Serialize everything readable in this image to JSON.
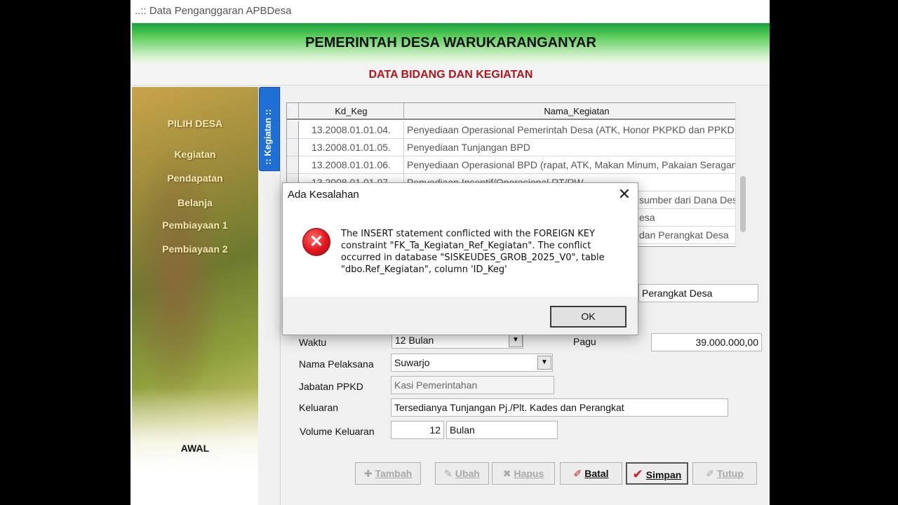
{
  "window": {
    "title": "..:: Data Penganggaran APBDesa"
  },
  "header": {
    "banner": "PEMERINTAH DESA WARUKARANGANYAR",
    "subtitle": "DATA BIDANG DAN KEGIATAN"
  },
  "sidebar": {
    "items": [
      {
        "label": "PILIH DESA"
      },
      {
        "label": "Kegiatan"
      },
      {
        "label": "Pendapatan"
      },
      {
        "label": "Belanja"
      },
      {
        "label": "Pembiayaan 1"
      },
      {
        "label": "Pembiayaan 2"
      }
    ],
    "awal": "AWAL"
  },
  "vertical_tab": {
    "label": ":: Kegiatan ::"
  },
  "grid": {
    "columns": [
      "Kd_Keg",
      "Nama_Kegiatan"
    ],
    "rows": [
      {
        "kd": "13.2008.01.01.04.",
        "nama": "Penyediaan Operasional Pemerintah Desa (ATK, Honor PKPKD dan PPKD dll)"
      },
      {
        "kd": "13.2008.01.01.05.",
        "nama": "Penyediaan Tunjangan BPD"
      },
      {
        "kd": "13.2008.01.01.06.",
        "nama": "Penyediaan Operasional BPD (rapat, ATK, Makan Minum, Pakaian Seragam, L"
      },
      {
        "kd": "13.2008.01.01.07.",
        "nama": "Penyediaan Insentif/Operasional RT/RW"
      },
      {
        "kd": "",
        "nama": "sumber dari Dana Desa"
      },
      {
        "kd": "",
        "nama": "esa"
      },
      {
        "kd": "",
        "nama": "dan Perangkat Desa"
      }
    ]
  },
  "form": {
    "nama_kegiatan_tail": "Perangkat Desa",
    "waktu": {
      "label": "Waktu",
      "value": "12 Bulan"
    },
    "pagu": {
      "label": "Pagu",
      "value": "39.000.000,00"
    },
    "nama_pelaksana": {
      "label": "Nama Pelaksana",
      "value": "Suwarjo"
    },
    "jabatan_ppkd": {
      "label": "Jabatan PPKD",
      "value": "Kasi Pemerintahan"
    },
    "keluaran": {
      "label": "Keluaran",
      "value": "Tersedianya Tunjangan Pj./Plt. Kades dan Perangkat"
    },
    "volume_keluaran": {
      "label": "Volume Keluaran",
      "value": "12",
      "unit": "Bulan"
    }
  },
  "toolbar": {
    "tambah": "Tambah",
    "ubah": "Ubah",
    "hapus": "Hapus",
    "batal": "Batal",
    "simpan": "Simpan",
    "tutup": "Tutup"
  },
  "dialog": {
    "title": "Ada Kesalahan",
    "message": "The INSERT statement conflicted with the FOREIGN KEY constraint \"FK_Ta_Kegiatan_Ref_Kegiatan\". The conflict occurred in database \"SISKEUDES_GROB_2025_V0\", table \"dbo.Ref_Kegiatan\", column 'ID_Keg'",
    "ok_label": "OK",
    "close_glyph": "✕",
    "icon": "error-icon"
  },
  "colors": {
    "banner_green": "#17a33a",
    "subtitle_red": "#b3151b",
    "tab_blue": "#1f6fd6",
    "error_red": "#e0161b"
  }
}
